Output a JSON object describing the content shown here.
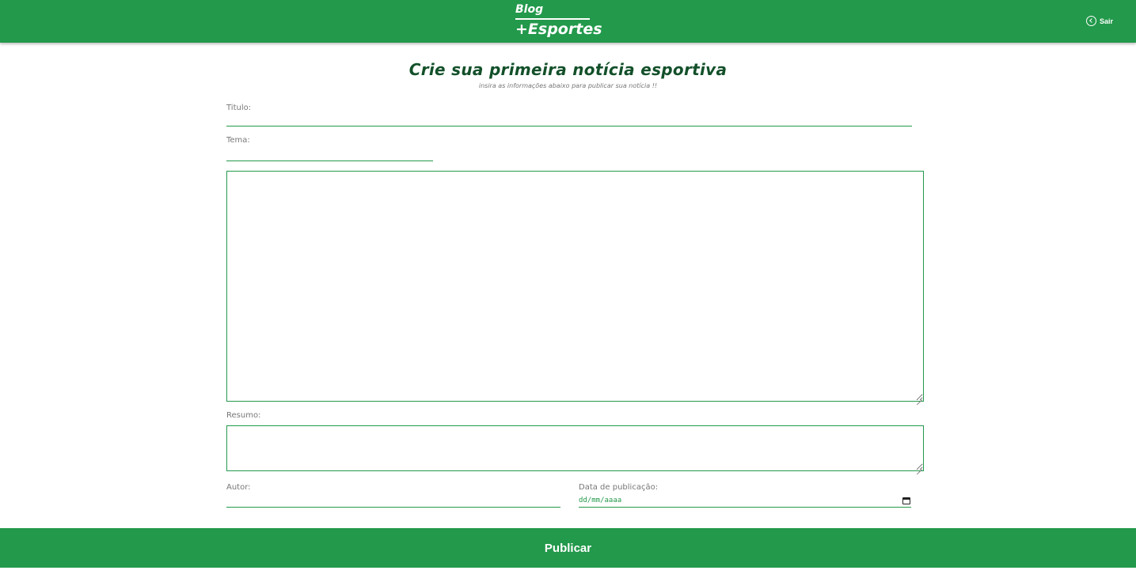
{
  "header": {
    "logo_top": "Blog",
    "logo_main": "+Esportes",
    "logout_label": "Sair",
    "logout_icon": "arrow-left-circle-icon"
  },
  "page": {
    "title": "Crie sua primeira notícia esportiva",
    "subtitle": "insira as informações abaixo para publicar sua notícia !!"
  },
  "form": {
    "title_label": "Titulo:",
    "title_value": "",
    "theme_label": "Tema:",
    "theme_value": "",
    "content_value": "",
    "summary_label": "Resumo:",
    "summary_value": "",
    "author_label": "Autor:",
    "author_value": "",
    "date_label": "Data de publicação:",
    "date_value": "dd/mm/aaaa",
    "date_icon": "calendar-icon"
  },
  "actions": {
    "publish_label": "Publicar"
  },
  "colors": {
    "brand": "#23994b",
    "title": "#13502a"
  }
}
